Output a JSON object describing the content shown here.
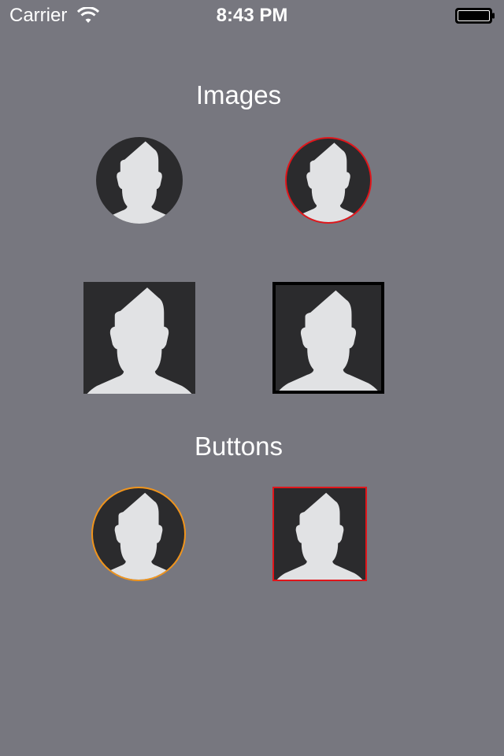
{
  "status_bar": {
    "carrier": "Carrier",
    "time": "8:43 PM",
    "wifi_icon": "wifi-icon",
    "battery_icon": "battery-icon"
  },
  "sections": {
    "images_title": "Images",
    "buttons_title": "Buttons"
  },
  "colors": {
    "background": "#77777f",
    "avatar_background": "#2b2b2d",
    "silhouette": "#e1e2e4",
    "red_border": "#e0161b",
    "black_border": "#000000",
    "orange_border": "#f0941c"
  },
  "images": [
    {
      "shape": "circle",
      "border": "none",
      "icon": "person-silhouette-icon"
    },
    {
      "shape": "circle",
      "border": "red",
      "icon": "person-silhouette-icon"
    },
    {
      "shape": "square",
      "border": "none",
      "icon": "person-silhouette-icon"
    },
    {
      "shape": "square",
      "border": "black",
      "icon": "person-silhouette-icon"
    }
  ],
  "buttons": [
    {
      "shape": "circle",
      "border": "orange",
      "icon": "person-silhouette-icon"
    },
    {
      "shape": "square",
      "border": "red",
      "icon": "person-silhouette-icon"
    }
  ]
}
